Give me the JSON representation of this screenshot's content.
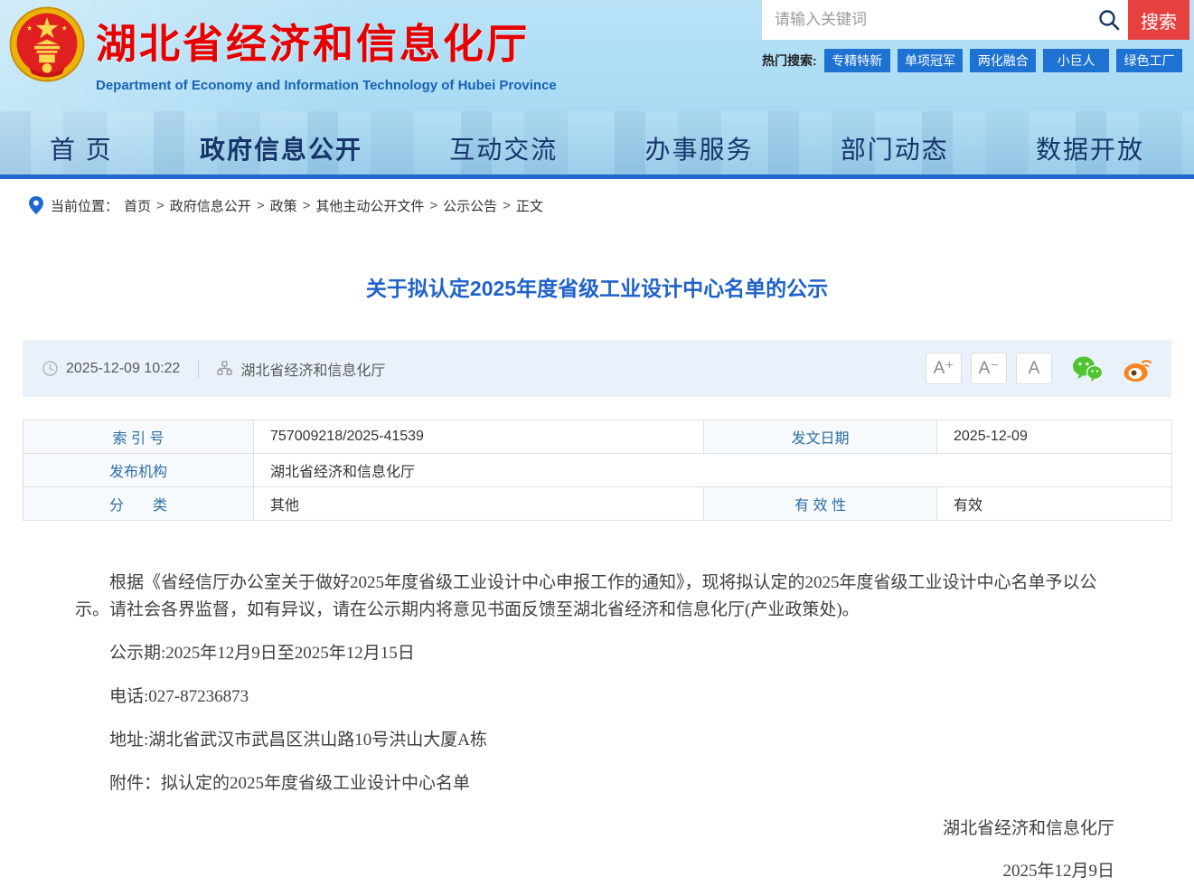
{
  "header": {
    "site_title": "湖北省经济和信息化厅",
    "site_subtitle": "Department of Economy and Information Technology of Hubei Province",
    "search": {
      "placeholder": "请输入关键词",
      "button_label": "搜索"
    },
    "hot_search": {
      "label": "热门搜索:",
      "tags": [
        {
          "label": "专精特新"
        },
        {
          "label": "单项冠军"
        },
        {
          "label": "两化融合"
        },
        {
          "label": "小巨人"
        },
        {
          "label": "绿色工厂"
        }
      ]
    }
  },
  "nav": {
    "items": [
      {
        "label": "首 页"
      },
      {
        "label": "政府信息公开"
      },
      {
        "label": "互动交流"
      },
      {
        "label": "办事服务"
      },
      {
        "label": "部门动态"
      },
      {
        "label": "数据开放"
      }
    ]
  },
  "breadcrumb": {
    "label": "当前位置：",
    "separator": ">",
    "items": [
      {
        "label": "首页"
      },
      {
        "label": "政府信息公开"
      },
      {
        "label": "政策"
      },
      {
        "label": "其他主动公开文件"
      },
      {
        "label": "公示公告"
      },
      {
        "label": "正文"
      }
    ]
  },
  "article": {
    "title": "关于拟认定2025年度省级工业设计中心名单的公示",
    "meta": {
      "datetime": "2025-12-09 10:22",
      "source": "湖北省经济和信息化厅",
      "font_buttons": [
        "A⁺",
        "A⁻",
        "A"
      ]
    },
    "info_table": {
      "row1": {
        "label1": "索 引 号",
        "value1": "757009218/2025-41539",
        "label2": "发文日期",
        "value2": "2025-12-09"
      },
      "row2": {
        "label1": "发布机构",
        "value1": "湖北省经济和信息化厅"
      },
      "row3": {
        "label1": "分　　类",
        "value1": "其他",
        "label2": "有 效 性",
        "value2": "有效"
      }
    },
    "body": {
      "paragraph1": "根据《省经信厅办公室关于做好2025年度省级工业设计中心申报工作的通知》，现将拟认定的2025年度省级工业设计中心名单予以公示。请社会各界监督，如有异议，请在公示期内将意见书面反馈至湖北省经济和信息化厅(产业政策处)。",
      "period_line": "公示期:2025年12月9日至2025年12月15日",
      "phone_line": "电话:027-87236873",
      "address_line": "地址:湖北省武汉市武昌区洪山路10号洪山大厦A栋",
      "attachment_label": "附件：",
      "attachment_name": "拟认定的2025年度省级工业设计中心名单"
    },
    "signature": {
      "org": "湖北省经济和信息化厅",
      "date": "2025年12月9日"
    }
  },
  "colors": {
    "brand_red": "#e60000",
    "accent_blue": "#1f66d1",
    "nav_text": "#17356b",
    "hot_tag_blue": "#1e72d2",
    "search_btn_red": "#e84040",
    "title_blue": "#1f62c9",
    "table_label_blue": "#2e6da4",
    "meta_bg": "#e9f2fa",
    "wechat_green": "#4fc332",
    "weibo_orange": "#f5851f"
  }
}
